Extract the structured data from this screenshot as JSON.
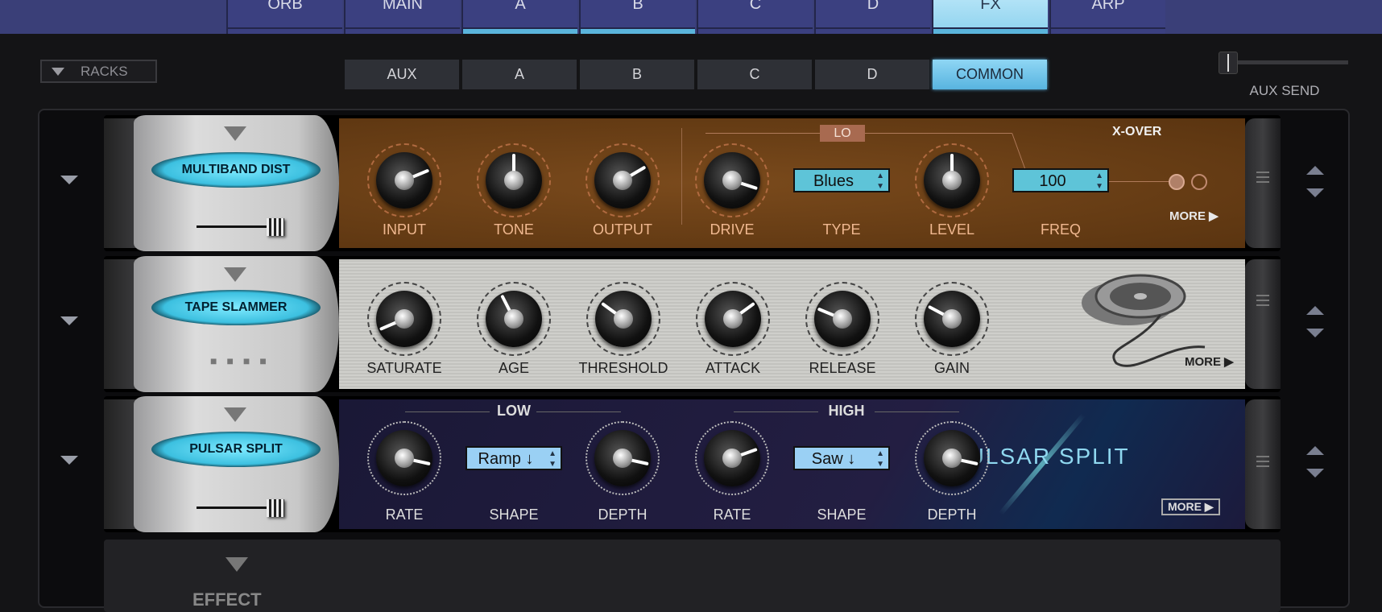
{
  "top_tabs": [
    {
      "label": "ORB",
      "indicator": false,
      "selected": false
    },
    {
      "label": "MAIN",
      "indicator": false,
      "selected": false
    },
    {
      "label": "A",
      "indicator": true,
      "selected": false
    },
    {
      "label": "B",
      "indicator": true,
      "selected": false
    },
    {
      "label": "C",
      "indicator": false,
      "selected": false
    },
    {
      "label": "D",
      "indicator": false,
      "selected": false
    },
    {
      "label": "FX",
      "indicator": true,
      "selected": true
    },
    {
      "label": "ARP",
      "indicator": false,
      "selected": false
    }
  ],
  "racks_label": "RACKS",
  "sub_tabs": [
    {
      "label": "AUX"
    },
    {
      "label": "A"
    },
    {
      "label": "B"
    },
    {
      "label": "C"
    },
    {
      "label": "D"
    },
    {
      "label": "COMMON",
      "selected": true
    }
  ],
  "aux_send": {
    "label": "AUX SEND",
    "value": 0.0
  },
  "colors": {
    "accent": "#5ab4e0",
    "topbar": "#3a3f78",
    "dist": "#6a3e14",
    "pulsar": "#1a1636"
  },
  "racks": [
    {
      "name": "MULTIBAND DIST",
      "mix": 0.9,
      "lo_label": "LO",
      "xover_label": "X-OVER",
      "more": "MORE ▶",
      "knobs": [
        {
          "label": "INPUT",
          "value": 0.75
        },
        {
          "label": "TONE",
          "value": 0.5
        },
        {
          "label": "OUTPUT",
          "value": 0.72
        },
        {
          "label": "DRIVE",
          "value": 0.9
        },
        {
          "label": "LEVEL",
          "value": 0.5
        }
      ],
      "type": {
        "label": "TYPE",
        "value": "Blues"
      },
      "freq": {
        "label": "FREQ",
        "value": "100"
      }
    },
    {
      "name": "TAPE SLAMMER",
      "more": "MORE ▶",
      "knobs": [
        {
          "label": "SATURATE",
          "value": 0.08
        },
        {
          "label": "AGE",
          "value": 0.4
        },
        {
          "label": "THRESHOLD",
          "value": 0.3
        },
        {
          "label": "ATTACK",
          "value": 0.7
        },
        {
          "label": "RELEASE",
          "value": 0.25
        },
        {
          "label": "GAIN",
          "value": 0.27
        }
      ]
    },
    {
      "name": "PULSAR SPLIT",
      "mix": 0.9,
      "low_label": "LOW",
      "high_label": "HIGH",
      "logo": "PULSAR SPLIT",
      "more": "MORE ▶",
      "knobs": [
        {
          "label": "RATE",
          "value": 0.88
        },
        {
          "label": "DEPTH",
          "value": 0.88
        },
        {
          "label": "RATE",
          "value": 0.76
        },
        {
          "label": "DEPTH",
          "value": 0.88
        }
      ],
      "shapes": [
        {
          "label": "SHAPE",
          "value": "Ramp ↓"
        },
        {
          "label": "SHAPE",
          "value": "Saw ↓"
        }
      ]
    }
  ],
  "empty_slot": {
    "label": "EFFECT"
  }
}
